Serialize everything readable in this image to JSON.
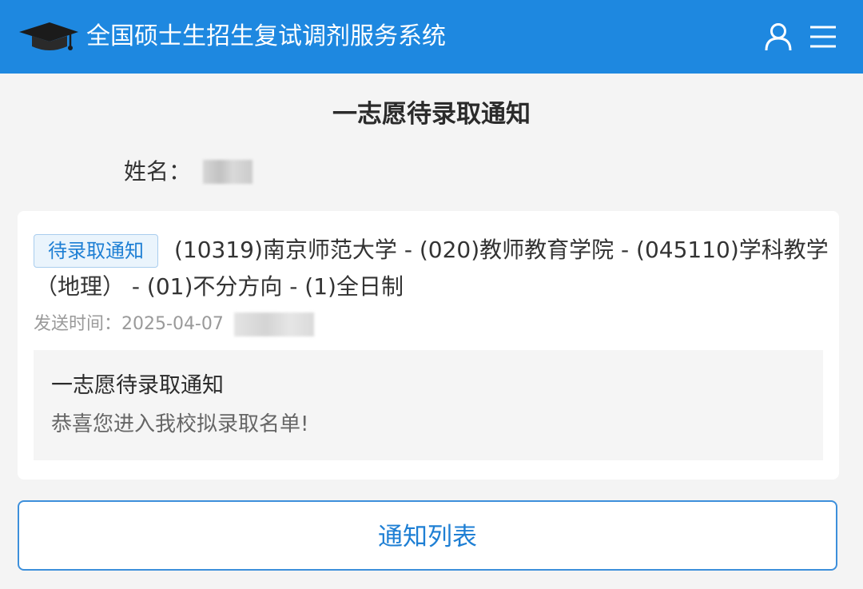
{
  "header": {
    "app_title": "全国硕士生招生复试调剂服务系统",
    "logo_icon": "graduation-cap-icon",
    "user_icon": "user-icon",
    "menu_icon": "menu-icon",
    "background_color": "#1e88e0"
  },
  "page": {
    "title": "一志愿待录取通知"
  },
  "applicant": {
    "name_label": "姓名："
  },
  "notice": {
    "status_badge": "待录取通知",
    "program_line1": "(10319)南京师范大学 - (020)教师教育学院 - (045110)学科教学",
    "program_line2": "（地理） - (01)不分方向 - (1)全日制",
    "send_time_label": "发送时间：",
    "send_time_value": "2025-04-07",
    "message_title": "一志愿待录取通知",
    "message_body": "恭喜您进入我校拟录取名单!"
  },
  "actions": {
    "notice_list_label": "通知列表"
  },
  "colors": {
    "accent": "#1e7fd4",
    "badge_bg": "#eaf4fc",
    "page_bg": "#f4f4f4"
  }
}
